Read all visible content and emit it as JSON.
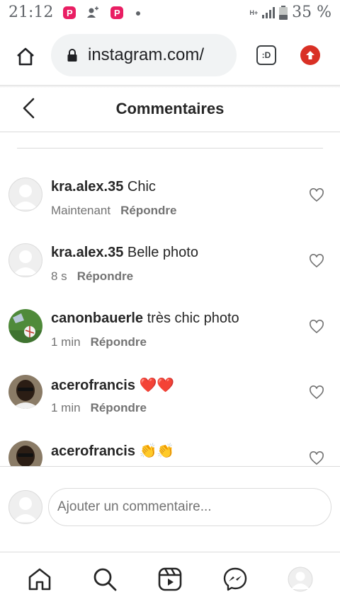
{
  "status_bar": {
    "time": "21:12",
    "network_label": "H+",
    "battery_percent": "35 %",
    "icons": [
      "pinterest-icon",
      "person-add-icon",
      "pinterest-icon",
      "dot-icon",
      "signal-icon",
      "battery-icon"
    ]
  },
  "browser": {
    "url": "instagram.com/",
    "tab_switcher_label": ":D",
    "icons": [
      "home-icon",
      "lock-icon",
      "update-icon"
    ]
  },
  "header": {
    "title": "Commentaires"
  },
  "comments": [
    {
      "username": "kra.alex.35",
      "text": "Chic",
      "time": "Maintenant",
      "reply": "Répondre",
      "avatar": "default"
    },
    {
      "username": "kra.alex.35",
      "text": "Belle photo",
      "time": "8 s",
      "reply": "Répondre",
      "avatar": "default"
    },
    {
      "username": "canonbauerle",
      "text": "très chic photo",
      "time": "1 min",
      "reply": "Répondre",
      "avatar": "photo"
    },
    {
      "username": "acerofrancis",
      "text": "❤️❤️",
      "time": "1 min",
      "reply": "Répondre",
      "avatar": "photo"
    },
    {
      "username": "acerofrancis",
      "text": "👏👏",
      "time": "",
      "reply": "",
      "avatar": "photo"
    }
  ],
  "comment_input": {
    "placeholder": "Ajouter un commentaire..."
  },
  "nav": [
    "home-icon",
    "search-icon",
    "reels-icon",
    "messenger-icon",
    "profile-icon"
  ]
}
